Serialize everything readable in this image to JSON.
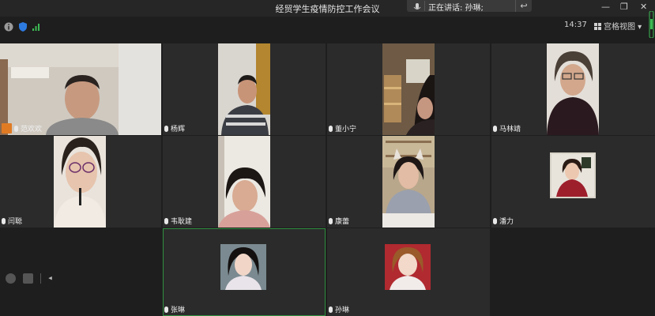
{
  "window": {
    "title": "经贸学生疫情防控工作会议"
  },
  "speaking": {
    "label": "正在讲话: 孙琳;"
  },
  "toolbar": {
    "time": "14:37",
    "view_label": "宫格视图"
  },
  "participants": [
    {
      "name": "范欢欢",
      "host": true
    },
    {
      "name": "杨辉"
    },
    {
      "name": "董小宁"
    },
    {
      "name": "马林靖"
    },
    {
      "name": "闫聪"
    },
    {
      "name": "韦耿建"
    },
    {
      "name": "康蕾"
    },
    {
      "name": "潘力"
    },
    {
      "name": "张琳"
    },
    {
      "name": "孙琳"
    }
  ]
}
